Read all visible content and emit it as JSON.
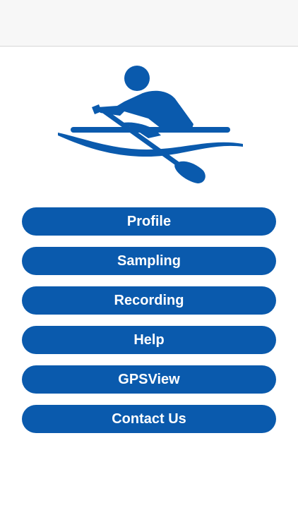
{
  "theme": {
    "brand_color": "#0a5aad",
    "nav_bar_color": "#f7f7f7"
  },
  "logo": {
    "icon": "rower-icon"
  },
  "menu": {
    "buttons": [
      {
        "label": "Profile"
      },
      {
        "label": "Sampling"
      },
      {
        "label": "Recording"
      },
      {
        "label": "Help"
      },
      {
        "label": "GPSView"
      },
      {
        "label": "Contact Us"
      }
    ]
  }
}
